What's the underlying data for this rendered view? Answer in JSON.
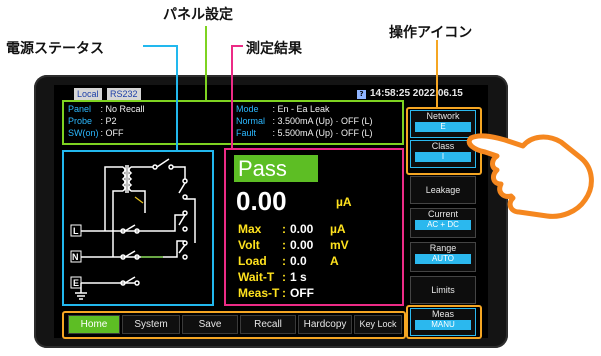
{
  "annotations": {
    "panel_settings": "パネル設定",
    "power_status": "電源ステータス",
    "measurement_result": "測定結果",
    "operation_icons": "操作アイコン"
  },
  "colors": {
    "panel_settings": "#7ed321",
    "power_status": "#22b8ee",
    "measurement_result": "#ec2b86",
    "operation_icons": "#f5a623",
    "pass_bg": "#5dbe24"
  },
  "topbar": {
    "local": "Local",
    "interface": "RS232",
    "clock": "14:58:25 2022.06.15"
  },
  "info": {
    "panel_key": "Panel",
    "panel_val": ": No Recall",
    "probe_key": "Probe",
    "probe_val": ":  P2",
    "sw_key": "SW(on)",
    "sw_val": ":  OFF",
    "mode_key": "Mode",
    "mode_val": ": En - Ea Leak",
    "normal_key": "Normal",
    "normal_val": ": 3.500mA (Up)  ·  OFF (L)",
    "fault_key": "Fault",
    "fault_val": ": 5.500mA (Up)  ·  OFF (L)"
  },
  "circuit": {
    "labels": [
      "L",
      "N",
      "E"
    ]
  },
  "measurement": {
    "status": "Pass",
    "value": "0.00",
    "unit": "µA",
    "rows": [
      {
        "label": "Max",
        "value": "0.00",
        "unit": "µA"
      },
      {
        "label": "Volt",
        "value": "0.00",
        "unit": "mV"
      },
      {
        "label": "Load",
        "value": "0.0",
        "unit": "A"
      },
      {
        "label": "Wait-T",
        "value": "1 s",
        "unit": ""
      },
      {
        "label": "Meas-T",
        "value": "OFF",
        "unit": ""
      }
    ]
  },
  "side_buttons": [
    {
      "label": "Network",
      "sub": "E"
    },
    {
      "label": "Class",
      "sub": "I"
    },
    {
      "label": "Leakage",
      "sub": ""
    },
    {
      "label": "Current",
      "sub": "AC + DC"
    },
    {
      "label": "Range",
      "sub": "AUTO"
    },
    {
      "label": "Limits",
      "sub": ""
    },
    {
      "label": "Meas",
      "sub": "MANU"
    }
  ],
  "bottom_buttons": [
    "Home",
    "System",
    "Save",
    "Recall",
    "Hardcopy",
    "Key Lock"
  ]
}
